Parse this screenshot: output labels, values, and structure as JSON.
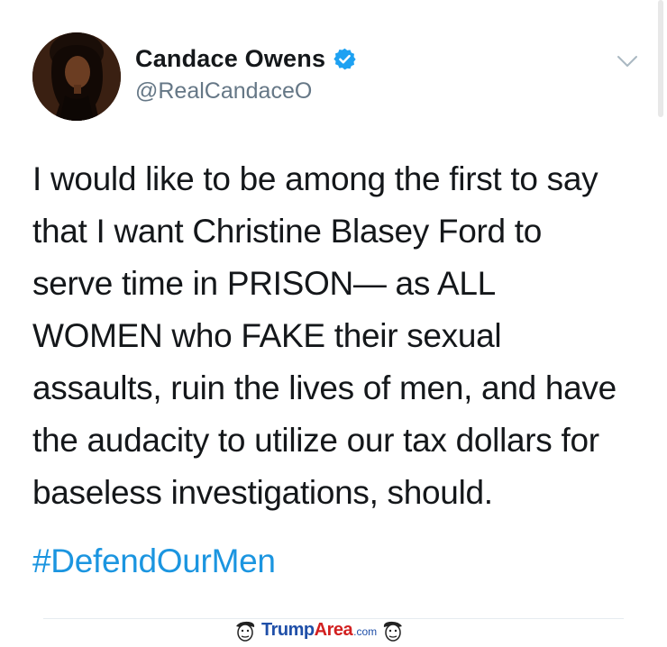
{
  "tweet": {
    "author": {
      "display_name": "Candace Owens",
      "handle": "@RealCandaceO",
      "verified": true,
      "avatar_icon": "profile-photo"
    },
    "menu_icon": "chevron-down-icon",
    "text": "I would like to be among the first to say\nthat I want Christine Blasey Ford to\nserve time in PRISON— as ALL\nWOMEN who FAKE their sexual\nassaults, ruin the lives of men, and have\nthe audacity to utilize our tax dollars for\nbaseless investigations, should.",
    "hashtag": "#DefendOurMen"
  },
  "watermark": {
    "brand_part1": "Trump",
    "brand_part2": "Area",
    "brand_suffix": ".com"
  },
  "colors": {
    "text": "#14171a",
    "secondary_text": "#657786",
    "link": "#1b95e0",
    "verified_badge": "#1da1f2",
    "divider": "#e6ecf0",
    "watermark_blue": "#1f4fa8",
    "watermark_red": "#d22020"
  }
}
